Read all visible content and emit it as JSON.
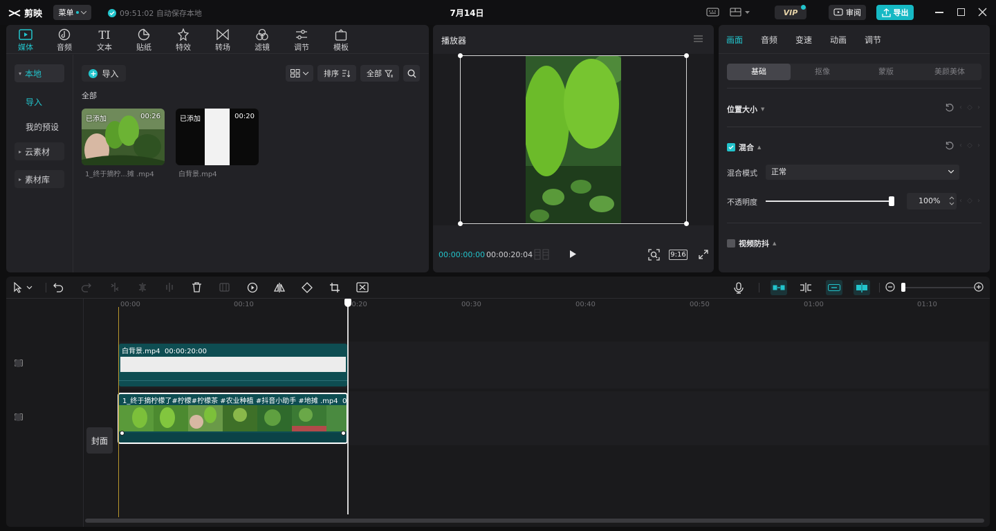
{
  "app": {
    "name": "剪映",
    "menu_label": "菜单",
    "autosave": "09:51:02 自动保存本地",
    "project_title": "7月14日",
    "vip_label": "VIP",
    "review_label": "审阅",
    "export_label": "导出"
  },
  "media": {
    "tabs": [
      {
        "label": "媒体"
      },
      {
        "label": "音频"
      },
      {
        "label": "文本"
      },
      {
        "label": "贴纸"
      },
      {
        "label": "特效"
      },
      {
        "label": "转场"
      },
      {
        "label": "滤镜"
      },
      {
        "label": "调节"
      },
      {
        "label": "模板"
      }
    ],
    "sidebar": {
      "local": "本地",
      "import": "导入",
      "presets": "我的预设",
      "cloud": "云素材",
      "library": "素材库"
    },
    "import_button": "导入",
    "sort_label": "排序",
    "filter_label": "全部",
    "section_label": "全部",
    "clips": [
      {
        "badge": "已添加",
        "duration": "00:26",
        "name": "1_终于摘柠...摊 .mp4"
      },
      {
        "badge": "已添加",
        "duration": "00:20",
        "name": "白背景.mp4"
      }
    ]
  },
  "player": {
    "title": "播放器",
    "current_time": "00:00:00:00",
    "total_time": "00:00:20:04",
    "ratio": "9:16"
  },
  "props": {
    "tabs": [
      {
        "label": "画面"
      },
      {
        "label": "音频"
      },
      {
        "label": "变速"
      },
      {
        "label": "动画"
      },
      {
        "label": "调节"
      }
    ],
    "segments": [
      {
        "label": "基础"
      },
      {
        "label": "抠像"
      },
      {
        "label": "蒙版"
      },
      {
        "label": "美颜美体"
      }
    ],
    "position_size": "位置大小",
    "blend": "混合",
    "blend_mode_label": "混合模式",
    "blend_mode_value": "正常",
    "opacity_label": "不透明度",
    "opacity_value": "100%",
    "stabilize": "视频防抖"
  },
  "timeline": {
    "ruler": [
      "00:00",
      "00:10",
      "00:20",
      "00:30",
      "00:40",
      "00:50",
      "01:00",
      "01:10"
    ],
    "cover_label": "封面",
    "bg_clip": {
      "name": "白背景.mp4",
      "duration": "00:00:20:00"
    },
    "main_clip": {
      "name": "1_终于摘柠檬了#柠檬#柠檬茶 #农业种植 #抖音小助手 #地摊 .mp4",
      "duration": "00:0"
    }
  },
  "colors": {
    "accent": "#22c4cc",
    "panel": "#222226",
    "clip": "#0e4d52"
  }
}
